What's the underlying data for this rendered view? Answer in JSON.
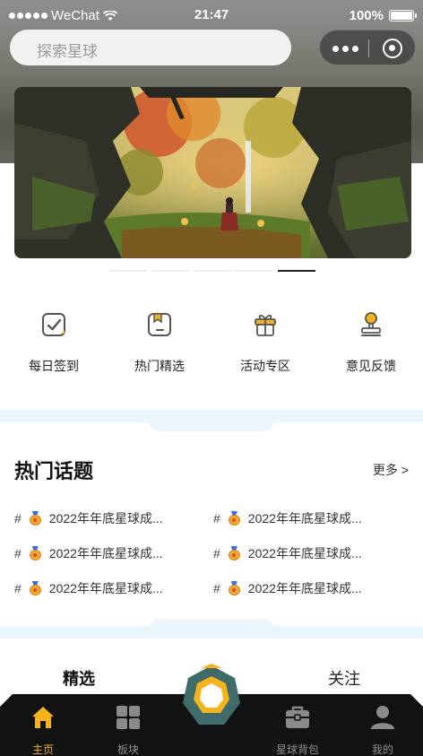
{
  "status_bar": {
    "carrier": "WeChat",
    "time": "21:47",
    "battery": "100%"
  },
  "search": {
    "placeholder": "探索星球"
  },
  "banner": {
    "slide_count": 5,
    "active_index": 4
  },
  "quick_menu": [
    {
      "label": "每日签到",
      "icon": "checkin-icon"
    },
    {
      "label": "热门精选",
      "icon": "bookmark-icon"
    },
    {
      "label": "活动专区",
      "icon": "gift-icon"
    },
    {
      "label": "意见反馈",
      "icon": "feedback-stamp-icon"
    }
  ],
  "hot_topics": {
    "title": "热门话题",
    "more": "更多 >",
    "items": [
      {
        "hash": "#",
        "text": "2022年年底星球成..."
      },
      {
        "hash": "#",
        "text": "2022年年底星球成..."
      },
      {
        "hash": "#",
        "text": "2022年年底星球成..."
      },
      {
        "hash": "#",
        "text": "2022年年底星球成..."
      },
      {
        "hash": "#",
        "text": "2022年年底星球成..."
      },
      {
        "hash": "#",
        "text": "2022年年底星球成..."
      }
    ]
  },
  "feed_tabs": {
    "selected": "精选",
    "follow": "关注"
  },
  "bottom_nav": [
    {
      "label": "主页",
      "icon": "home-icon",
      "active": true
    },
    {
      "label": "板块",
      "icon": "grid-icon",
      "active": false
    },
    {
      "label": "星球背包",
      "icon": "briefcase-icon",
      "active": false
    },
    {
      "label": "我的",
      "icon": "user-icon",
      "active": false
    }
  ],
  "colors": {
    "accent": "#f4b31a",
    "nav_bg": "#121212",
    "band": "#eaf5fc",
    "center_button": "#3f6b6a"
  }
}
